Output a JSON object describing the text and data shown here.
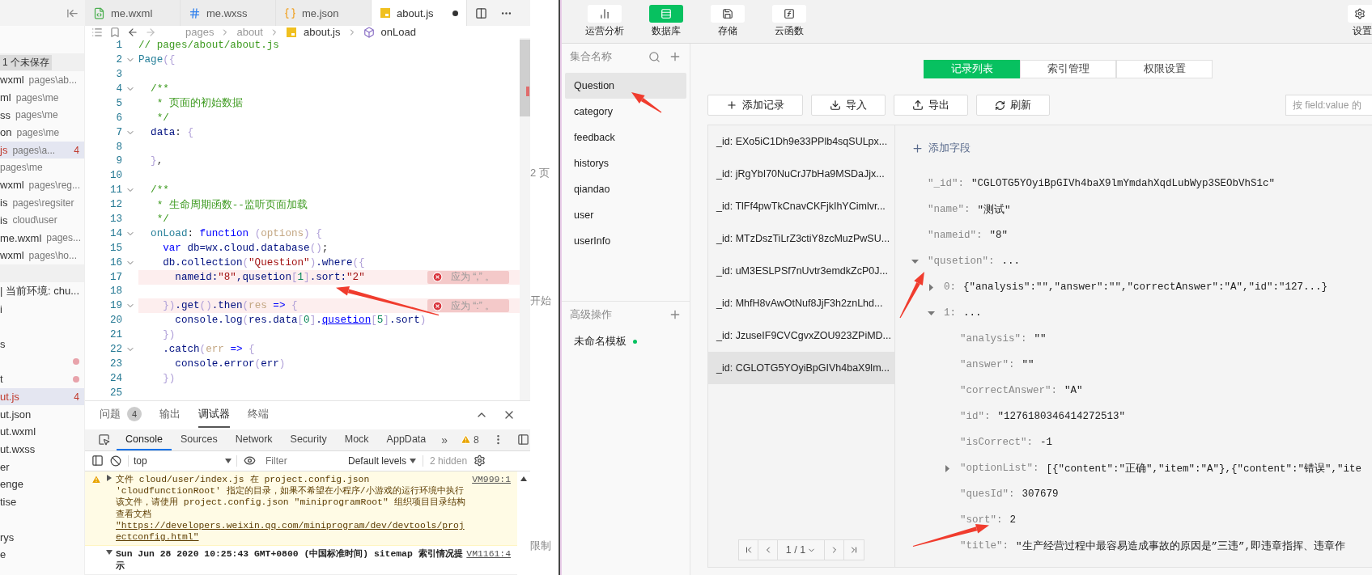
{
  "editor_tabs": [
    {
      "label": "me.wxml",
      "kind": "wxml",
      "selected": false,
      "modified": false
    },
    {
      "label": "me.wxss",
      "kind": "wxss",
      "selected": false,
      "modified": false
    },
    {
      "label": "me.json",
      "kind": "json",
      "selected": false,
      "modified": false
    },
    {
      "label": "about.js",
      "kind": "js",
      "selected": true,
      "modified": true
    }
  ],
  "breadcrumb": [
    {
      "label": "pages",
      "kind": "folder"
    },
    {
      "label": "about",
      "kind": "folder"
    },
    {
      "label": "about.js",
      "kind": "file"
    },
    {
      "label": "onLoad",
      "kind": "symbol"
    }
  ],
  "open_editors": {
    "header": "1 个未保存",
    "items": [
      {
        "label": "wxml",
        "path": "pages\\ab...",
        "selected": false
      },
      {
        "label": "ml",
        "path": "pages\\me",
        "selected": false
      },
      {
        "label": "ss",
        "path": "pages\\me",
        "selected": false
      },
      {
        "label": "on",
        "path": "pages\\me",
        "selected": false
      },
      {
        "label": "js",
        "path": "pages\\a...",
        "badge": "4",
        "selected": true
      },
      {
        "path": "pages\\me",
        "selected": false
      },
      {
        "label": "wxml",
        "path": "pages\\reg...",
        "selected": false
      },
      {
        "label": "is",
        "path": "pages\\regsiter",
        "selected": false
      },
      {
        "label": "is",
        "path": "cloud\\user",
        "selected": false
      },
      {
        "label": "me.wxml",
        "path": "pages...",
        "selected": false
      },
      {
        "label": "wxml",
        "path": "pages\\ho...",
        "selected": false
      }
    ]
  },
  "files": [
    {
      "kind": "file",
      "label": "| 当前环境: chu...",
      "selected": false,
      "modified": false
    },
    {
      "kind": "file",
      "label": "i",
      "selected": false,
      "modified": false
    },
    {
      "kind": "blank"
    },
    {
      "kind": "file",
      "label": "s",
      "selected": false,
      "modified": false
    },
    {
      "kind": "file",
      "selected": false,
      "modified": true
    },
    {
      "kind": "file",
      "label": "t",
      "selected": false,
      "modified": true
    },
    {
      "kind": "file",
      "label": "ut.js",
      "badge": "4",
      "selected": true,
      "modified": false
    },
    {
      "kind": "file",
      "label": "ut.json",
      "selected": false,
      "modified": false
    },
    {
      "kind": "file",
      "label": "ut.wxml",
      "selected": false,
      "modified": false
    },
    {
      "kind": "file",
      "label": "ut.wxss",
      "selected": false,
      "modified": false
    },
    {
      "kind": "file",
      "label": "er",
      "selected": false,
      "modified": false
    },
    {
      "kind": "file",
      "label": "enge",
      "selected": false,
      "modified": false
    },
    {
      "kind": "file",
      "label": "tise",
      "selected": false,
      "modified": false
    },
    {
      "kind": "blank"
    },
    {
      "kind": "file",
      "label": "rys",
      "selected": false,
      "modified": false
    },
    {
      "kind": "file",
      "label": "e",
      "selected": false,
      "modified": false
    }
  ],
  "code_lines": [
    {
      "number": "1",
      "fold": false,
      "tokens": [
        {
          "kind": "com",
          "text": "// pages/about/about.js"
        }
      ]
    },
    {
      "number": "2",
      "fold": true,
      "tokens": [
        {
          "kind": "fn",
          "text": "Page"
        },
        {
          "kind": "br",
          "text": "({"
        }
      ]
    },
    {
      "number": "3",
      "fold": false
    },
    {
      "number": "4",
      "fold": true,
      "tokens": [
        {
          "kind": "com",
          "text": "  /**"
        }
      ]
    },
    {
      "number": "5",
      "fold": false,
      "tokens": [
        {
          "kind": "com",
          "text": "   * 页面的初始数据"
        }
      ]
    },
    {
      "number": "6",
      "fold": false,
      "tokens": [
        {
          "kind": "com",
          "text": "   */"
        }
      ]
    },
    {
      "number": "7",
      "fold": true,
      "tokens": [
        {
          "kind": "plain",
          "text": "  data"
        },
        {
          "kind": "punct",
          "text": ": "
        },
        {
          "kind": "br",
          "text": "{"
        }
      ]
    },
    {
      "number": "8",
      "fold": false
    },
    {
      "number": "9",
      "fold": false,
      "tokens": [
        {
          "kind": "br",
          "text": "  }"
        },
        {
          "kind": "punct",
          "text": ","
        }
      ]
    },
    {
      "number": "10",
      "fold": false
    },
    {
      "number": "11",
      "fold": true,
      "tokens": [
        {
          "kind": "com",
          "text": "  /**"
        }
      ]
    },
    {
      "number": "12",
      "fold": false,
      "tokens": [
        {
          "kind": "com",
          "text": "   * 生命周期函数--监听页面加载"
        }
      ]
    },
    {
      "number": "13",
      "fold": false,
      "tokens": [
        {
          "kind": "com",
          "text": "   */"
        }
      ]
    },
    {
      "number": "14",
      "fold": true,
      "tokens": [
        {
          "kind": "fn",
          "text": "  onLoad"
        },
        {
          "kind": "punct",
          "text": ": "
        },
        {
          "kind": "kw",
          "text": "function "
        },
        {
          "kind": "br",
          "text": "("
        },
        {
          "kind": "param",
          "text": "options"
        },
        {
          "kind": "br",
          "text": ") {"
        }
      ]
    },
    {
      "number": "15",
      "fold": false,
      "tokens": [
        {
          "kind": "kw",
          "text": "    var"
        },
        {
          "kind": "plain",
          "text": " db=wx.cloud.database"
        },
        {
          "kind": "br",
          "text": "()"
        },
        {
          "kind": "punct",
          "text": ";"
        }
      ]
    },
    {
      "number": "16",
      "fold": true,
      "tokens": [
        {
          "kind": "plain",
          "text": "    db.collection"
        },
        {
          "kind": "br",
          "text": "("
        },
        {
          "kind": "str",
          "text": "\"Question\""
        },
        {
          "kind": "br",
          "text": ")"
        },
        {
          "kind": "plain",
          "text": ".where"
        },
        {
          "kind": "br",
          "text": "({"
        }
      ]
    },
    {
      "number": "17",
      "fold": false,
      "error": "应为 “,” 。",
      "tokens": [
        {
          "kind": "plain",
          "text": "      nameid:"
        },
        {
          "kind": "str",
          "text": "\"8\""
        },
        {
          "kind": "plain",
          "text": ",qusetion"
        },
        {
          "kind": "br",
          "text": "["
        },
        {
          "kind": "num",
          "text": "1"
        },
        {
          "kind": "br",
          "text": "]"
        },
        {
          "kind": "plain",
          "text": ".sort:"
        },
        {
          "kind": "str",
          "text": "\"2\""
        }
      ]
    },
    {
      "number": "18",
      "fold": false
    },
    {
      "number": "19",
      "fold": true,
      "error": "应为 “:” 。",
      "tokens": [
        {
          "kind": "br",
          "text": "    })"
        },
        {
          "kind": "plain",
          "text": ".get"
        },
        {
          "kind": "br",
          "text": "()"
        },
        {
          "kind": "plain",
          "text": ".then"
        },
        {
          "kind": "br",
          "text": "("
        },
        {
          "kind": "param",
          "text": "res"
        },
        {
          "kind": "kw",
          "text": " => "
        },
        {
          "kind": "br",
          "text": "{"
        }
      ]
    },
    {
      "number": "20",
      "fold": false,
      "tokens": [
        {
          "kind": "plain",
          "text": "      console.log"
        },
        {
          "kind": "br",
          "text": "("
        },
        {
          "kind": "plain",
          "text": "res.data"
        },
        {
          "kind": "br",
          "text": "["
        },
        {
          "kind": "num",
          "text": "0"
        },
        {
          "kind": "br",
          "text": "]"
        },
        {
          "kind": "plain",
          "text": "."
        },
        {
          "kind": "link",
          "text": "qusetion"
        },
        {
          "kind": "br",
          "text": "["
        },
        {
          "kind": "num",
          "text": "5"
        },
        {
          "kind": "br",
          "text": "]"
        },
        {
          "kind": "plain",
          "text": ".sort"
        },
        {
          "kind": "br",
          "text": ")"
        }
      ]
    },
    {
      "number": "21",
      "fold": false,
      "tokens": [
        {
          "kind": "br",
          "text": "    })"
        }
      ]
    },
    {
      "number": "22",
      "fold": true,
      "tokens": [
        {
          "kind": "plain",
          "text": "    .catch"
        },
        {
          "kind": "br",
          "text": "("
        },
        {
          "kind": "param",
          "text": "err"
        },
        {
          "kind": "kw",
          "text": " => "
        },
        {
          "kind": "br",
          "text": "{"
        }
      ]
    },
    {
      "number": "23",
      "fold": false,
      "tokens": [
        {
          "kind": "plain",
          "text": "      console.error"
        },
        {
          "kind": "br",
          "text": "("
        },
        {
          "kind": "plain",
          "text": "err"
        },
        {
          "kind": "br",
          "text": ")"
        }
      ]
    },
    {
      "number": "24",
      "fold": false,
      "tokens": [
        {
          "kind": "br",
          "text": "    })"
        }
      ]
    },
    {
      "number": "25",
      "fold": false
    }
  ],
  "panel_tabs": [
    {
      "label": "问题",
      "badge": "4",
      "selected": false
    },
    {
      "label": "输出",
      "selected": false
    },
    {
      "label": "调试器",
      "selected": true
    },
    {
      "label": "终端",
      "selected": false
    }
  ],
  "devtools_tabs": [
    {
      "label": "Console",
      "selected": true
    },
    {
      "label": "Sources",
      "selected": false
    },
    {
      "label": "Network",
      "selected": false
    },
    {
      "label": "Security",
      "selected": false
    },
    {
      "label": "Mock",
      "selected": false
    },
    {
      "label": "AppData",
      "selected": false
    }
  ],
  "devtools_more": "»",
  "warning_count": "8",
  "console_toolbar": {
    "context": "top",
    "filter_placeholder": "Filter",
    "levels": "Default levels",
    "hidden": "2 hidden"
  },
  "console_messages": [
    {
      "kind": "warning",
      "text": "文件 cloud/user/index.js 在 project.config.json 'cloudfunctionRoot' 指定的目录，如果不希望在小程序/小游戏的运行环境中执行该文件，请使用 project.config.json \"miniprogramRoot\" 组织项目目录结构",
      "doc": "查看文档",
      "url": "\"https://developers.weixin.qq.com/miniprogram/dev/devtools/projectconfig.html\"",
      "source": "VM999:1",
      "expanded": false
    },
    {
      "kind": "log",
      "text": "Sun Jun 28 2020 10:25:43 GMT+0800 (中国标准时间) sitemap 索引情况提示",
      "source": "VM1161:4",
      "expanded": true
    }
  ],
  "background_window": [
    "2 页",
    "开始",
    "限制"
  ],
  "cloud_toolbar": [
    {
      "label": "运营分析",
      "kind": "chart",
      "selected": false
    },
    {
      "label": "数据库",
      "kind": "database",
      "selected": true
    },
    {
      "label": "存储",
      "kind": "storage",
      "selected": false
    },
    {
      "label": "云函数",
      "kind": "function",
      "selected": false
    }
  ],
  "settings_label": "设置",
  "collections": {
    "header": "集合名称",
    "items": [
      {
        "label": "Question",
        "selected": true
      },
      {
        "label": "category",
        "selected": false
      },
      {
        "label": "feedback",
        "selected": false
      },
      {
        "label": "historys",
        "selected": false
      },
      {
        "label": "qiandao",
        "selected": false
      },
      {
        "label": "user",
        "selected": false
      },
      {
        "label": "userInfo",
        "selected": false
      }
    ]
  },
  "advanced": {
    "header": "高级操作",
    "items": [
      {
        "label": "未命名模板",
        "color": "#07c160"
      }
    ]
  },
  "db_tabs": [
    {
      "label": "记录列表",
      "selected": true
    },
    {
      "label": "索引管理",
      "selected": false
    },
    {
      "label": "权限设置",
      "selected": false
    }
  ],
  "actions": [
    {
      "label": "添加记录",
      "kind": "add"
    },
    {
      "label": "导入",
      "kind": "import"
    },
    {
      "label": "导出",
      "kind": "export"
    },
    {
      "label": "刷新",
      "kind": "refresh"
    }
  ],
  "search": {
    "placeholder": "按 field:value 的"
  },
  "records": [
    {
      "label": "_id: EXo5iC1Dh9e33PPlb4sqSULpx...",
      "selected": false
    },
    {
      "label": "_id: jRgYbI70NuCrJ7bHa9MSDaJjx...",
      "selected": false
    },
    {
      "label": "_id: TlFf4pwTkCnavCKFjkIhYCimlvr...",
      "selected": false
    },
    {
      "label": "_id: MTzDszTiLrZ3ctiY8zcMuzPwSU...",
      "selected": false
    },
    {
      "label": "_id: uM3ESLPSf7nUvtr3emdkZcP0J...",
      "selected": false
    },
    {
      "label": "_id: MhfH8vAwOtNuf8JjF3h2znLhd...",
      "selected": false
    },
    {
      "label": "_id: JzuseIF9CVCgvxZOU923ZPiMD...",
      "selected": false
    },
    {
      "label": "_id: CGLOTG5YOyiBpGIVh4baX9lm...",
      "selected": true
    }
  ],
  "pagination": {
    "page": "1 / 1"
  },
  "add_field": "添加字段",
  "document": [
    {
      "key": "\"_id\":",
      "value": "\"CGLOTG5YOyiBpGIVh4baX9lmYmdahXqdLubWyp3SEObVhS1c\""
    },
    {
      "key": "\"name\":",
      "value": "\"测试\""
    },
    {
      "key": "\"nameid\":",
      "value": "\"8\""
    },
    {
      "key": "\"qusetion\":",
      "value": "...",
      "expanded": true,
      "children": [
        {
          "key": "0:",
          "value": "{\"analysis\":\"\",\"answer\":\"\",\"correctAnswer\":\"A\",\"id\":\"127...}",
          "expanded": false
        },
        {
          "key": "1:",
          "value": "...",
          "expanded": true,
          "children": [
            {
              "key": "\"analysis\":",
              "value": "\"\""
            },
            {
              "key": "\"answer\":",
              "value": "\"\""
            },
            {
              "key": "\"correctAnswer\":",
              "value": "\"A\""
            },
            {
              "key": "\"id\":",
              "value": "\"1276180346414272513\""
            },
            {
              "key": "\"isCorrect\":",
              "value": "-1"
            },
            {
              "key": "\"optionList\":",
              "value": "[{\"content\":\"正确\",\"item\":\"A\"},{\"content\":\"错误\",\"ite",
              "expanded": false
            },
            {
              "key": "\"quesId\":",
              "value": "307679"
            },
            {
              "key": "\"sort\":",
              "value": "2"
            },
            {
              "key": "\"title\":",
              "value": "\"生产经营过程中最容易造成事故的原因是”三违”,即违章指挥、违章作"
            }
          ]
        }
      ]
    }
  ]
}
